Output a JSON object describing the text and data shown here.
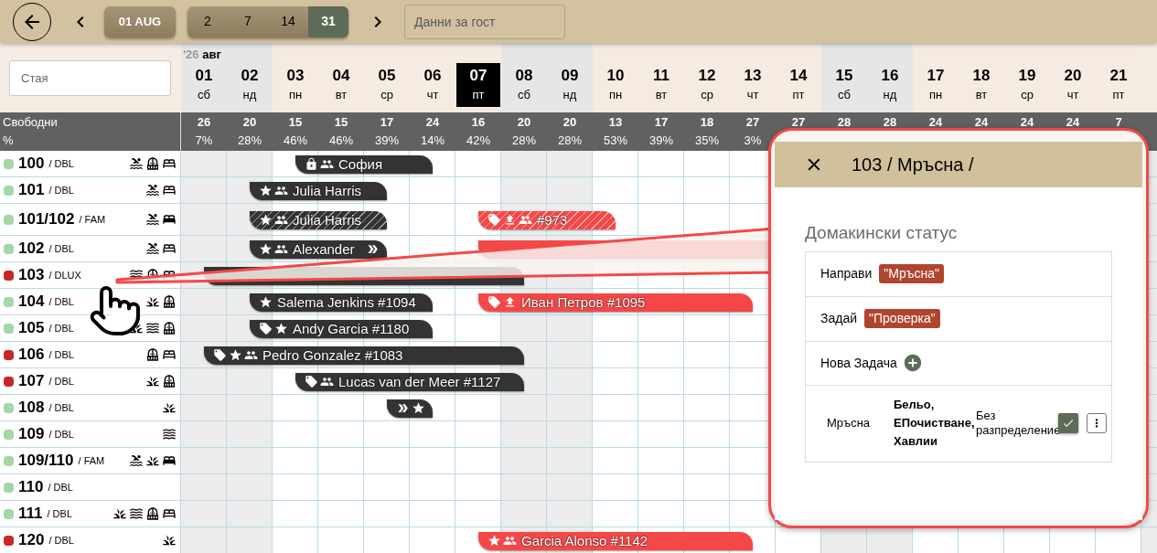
{
  "toolbar": {
    "date_button": "01 AUG",
    "ranges": [
      {
        "label": "2",
        "selected": false
      },
      {
        "label": "7",
        "selected": false
      },
      {
        "label": "14",
        "selected": false
      },
      {
        "label": "31",
        "selected": true
      }
    ],
    "guest_search": {
      "placeholder": "Данни за гост"
    }
  },
  "room_search": {
    "placeholder": "Стая"
  },
  "month": {
    "year": "'26",
    "name": "авг"
  },
  "stats_labels": [
    "Свободни",
    "%"
  ],
  "days": [
    {
      "date": "01",
      "weekday": "сб",
      "weekend": true,
      "selected": false,
      "free": "26",
      "pct": "7%"
    },
    {
      "date": "02",
      "weekday": "нд",
      "weekend": true,
      "selected": false,
      "free": "20",
      "pct": "28%"
    },
    {
      "date": "03",
      "weekday": "пн",
      "weekend": false,
      "selected": false,
      "free": "15",
      "pct": "46%"
    },
    {
      "date": "04",
      "weekday": "вт",
      "weekend": false,
      "selected": false,
      "free": "15",
      "pct": "46%"
    },
    {
      "date": "05",
      "weekday": "ср",
      "weekend": false,
      "selected": false,
      "free": "17",
      "pct": "39%"
    },
    {
      "date": "06",
      "weekday": "чт",
      "weekend": false,
      "selected": false,
      "free": "24",
      "pct": "14%"
    },
    {
      "date": "07",
      "weekday": "пт",
      "weekend": false,
      "selected": true,
      "free": "16",
      "pct": "42%"
    },
    {
      "date": "08",
      "weekday": "сб",
      "weekend": true,
      "selected": false,
      "free": "20",
      "pct": "28%"
    },
    {
      "date": "09",
      "weekday": "нд",
      "weekend": true,
      "selected": false,
      "free": "20",
      "pct": "28%"
    },
    {
      "date": "10",
      "weekday": "пн",
      "weekend": false,
      "selected": false,
      "free": "13",
      "pct": "53%"
    },
    {
      "date": "11",
      "weekday": "вт",
      "weekend": false,
      "selected": false,
      "free": "17",
      "pct": "39%"
    },
    {
      "date": "12",
      "weekday": "ср",
      "weekend": false,
      "selected": false,
      "free": "18",
      "pct": "35%"
    },
    {
      "date": "13",
      "weekday": "чт",
      "weekend": false,
      "selected": false,
      "free": "27",
      "pct": "3%"
    },
    {
      "date": "14",
      "weekday": "пт",
      "weekend": false,
      "selected": false,
      "free": "27"
    },
    {
      "date": "15",
      "weekday": "сб",
      "weekend": true,
      "selected": false,
      "free": "28"
    },
    {
      "date": "16",
      "weekday": "нд",
      "weekend": true,
      "selected": false,
      "free": "28"
    },
    {
      "date": "17",
      "weekday": "пн",
      "weekend": false,
      "selected": false,
      "free": "24"
    },
    {
      "date": "18",
      "weekday": "вт",
      "weekend": false,
      "selected": false,
      "free": "24"
    },
    {
      "date": "19",
      "weekday": "ср",
      "weekend": false,
      "selected": false,
      "free": "24"
    },
    {
      "date": "20",
      "weekday": "чт",
      "weekend": false,
      "selected": false,
      "free": "24"
    },
    {
      "date": "21",
      "weekday": "пт",
      "weekend": false,
      "selected": false,
      "free": "7"
    }
  ],
  "rooms": [
    {
      "number": "100",
      "type": "/ DBL",
      "color": "#a5d6a7",
      "tall": false,
      "amenities": [
        {
          "kind": "pool"
        },
        {
          "kind": "balcony"
        },
        {
          "kind": "bed"
        }
      ],
      "timeline": [
        {
          "kind": "gap"
        },
        {
          "kind": "gap"
        },
        {
          "kind": "booking",
          "color": "#333333",
          "striped": false,
          "icons": [
            {
              "kind": "lock"
            },
            {
              "kind": "people"
            }
          ],
          "label": "София",
          "nights": [
            {
              "kind": "night"
            },
            {
              "kind": "night"
            },
            {
              "kind": "night"
            }
          ]
        }
      ]
    },
    {
      "number": "101",
      "type": "/ DBL",
      "color": "#a5d6a7",
      "tall": false,
      "amenities": [
        {
          "kind": "pool"
        },
        {
          "kind": "bed"
        }
      ],
      "timeline": [
        {
          "kind": "gap"
        },
        {
          "kind": "booking",
          "color": "#333333",
          "striped": false,
          "icons": [
            {
              "kind": "star"
            },
            {
              "kind": "people"
            }
          ],
          "label": "Julia Harris",
          "nights": [
            {
              "kind": "night"
            },
            {
              "kind": "night"
            },
            {
              "kind": "night"
            }
          ]
        }
      ]
    },
    {
      "number": "101/102",
      "type": "/ FAM",
      "color": "#a5d6a7",
      "tall": true,
      "amenities": [
        {
          "kind": "pool"
        },
        {
          "kind": "bed-filled"
        }
      ],
      "timeline": [
        {
          "kind": "gap"
        },
        {
          "kind": "booking",
          "color": "#333333",
          "striped": true,
          "icons": [
            {
              "kind": "star"
            },
            {
              "kind": "people"
            }
          ],
          "label": "Julia Harris",
          "nights": [
            {
              "kind": "night"
            },
            {
              "kind": "night"
            },
            {
              "kind": "night"
            }
          ]
        },
        {
          "kind": "gap"
        },
        {
          "kind": "gap"
        },
        {
          "kind": "booking",
          "color": "#f44848",
          "striped": true,
          "icons": [
            {
              "kind": "tag"
            },
            {
              "kind": "upload"
            },
            {
              "kind": "people"
            }
          ],
          "label": "#973",
          "nights": [
            {
              "kind": "night"
            },
            {
              "kind": "night"
            },
            {
              "kind": "night"
            }
          ]
        }
      ]
    },
    {
      "number": "102",
      "type": "/ DBL",
      "color": "#a5d6a7",
      "tall": false,
      "amenities": [
        {
          "kind": "pool"
        },
        {
          "kind": "bed"
        }
      ],
      "timeline": [
        {
          "kind": "gap"
        },
        {
          "kind": "booking",
          "color": "#333333",
          "striped": false,
          "icons": [
            {
              "kind": "star"
            },
            {
              "kind": "people"
            }
          ],
          "label": "Alexander",
          "end_icons": [
            {
              "kind": "double-arrow"
            }
          ],
          "nights": [
            {
              "kind": "night"
            },
            {
              "kind": "night"
            },
            {
              "kind": "night"
            }
          ]
        },
        {
          "kind": "gap"
        },
        {
          "kind": "gap"
        },
        {
          "kind": "booking",
          "color": "#f44848",
          "striped": false,
          "nights": [
            {
              "kind": "night"
            },
            {
              "kind": "night"
            },
            {
              "kind": "night"
            },
            {
              "kind": "night"
            },
            {
              "kind": "night"
            },
            {
              "kind": "night"
            },
            {
              "kind": "night"
            }
          ]
        }
      ]
    },
    {
      "number": "103",
      "type": "/ DLUX",
      "color": "#c62828",
      "tall": false,
      "amenities": [
        {
          "kind": "waves"
        },
        {
          "kind": "balcony"
        },
        {
          "kind": "bed"
        }
      ],
      "timeline": [
        {
          "kind": "booking",
          "color": "#333333",
          "striped": false,
          "nights": [
            {
              "kind": "night"
            },
            {
              "kind": "night"
            },
            {
              "kind": "night"
            },
            {
              "kind": "night"
            },
            {
              "kind": "night"
            },
            {
              "kind": "night"
            },
            {
              "kind": "night"
            }
          ]
        }
      ]
    },
    {
      "number": "104",
      "type": "/ DBL",
      "color": "#a5d6a7",
      "tall": false,
      "amenities": [
        {
          "kind": "plant"
        },
        {
          "kind": "balcony"
        }
      ],
      "timeline": [
        {
          "kind": "gap"
        },
        {
          "kind": "booking",
          "color": "#333333",
          "striped": false,
          "icons": [
            {
              "kind": "star"
            }
          ],
          "label": "Salema Jenkins #1094",
          "nights": [
            {
              "kind": "night"
            },
            {
              "kind": "night"
            },
            {
              "kind": "night"
            },
            {
              "kind": "night"
            }
          ]
        },
        {
          "kind": "gap"
        },
        {
          "kind": "booking",
          "color": "#f44848",
          "striped": false,
          "icons": [
            {
              "kind": "tag"
            },
            {
              "kind": "upload"
            }
          ],
          "label": "Иван Петров #1095",
          "nights": [
            {
              "kind": "night"
            },
            {
              "kind": "night"
            },
            {
              "kind": "night"
            },
            {
              "kind": "night"
            },
            {
              "kind": "night"
            },
            {
              "kind": "night"
            }
          ]
        }
      ]
    },
    {
      "number": "105",
      "type": "/ DBL",
      "color": "#a5d6a7",
      "tall": false,
      "amenities": [
        {
          "kind": "plant"
        },
        {
          "kind": "waves"
        },
        {
          "kind": "balcony"
        }
      ],
      "timeline": [
        {
          "kind": "gap"
        },
        {
          "kind": "booking",
          "color": "#333333",
          "striped": false,
          "icons": [
            {
              "kind": "tag"
            },
            {
              "kind": "star"
            }
          ],
          "label": "Andy Garcia #1180",
          "nights": [
            {
              "kind": "night"
            },
            {
              "kind": "night"
            },
            {
              "kind": "night"
            },
            {
              "kind": "night"
            }
          ]
        }
      ]
    },
    {
      "number": "106",
      "type": "/ DBL",
      "color": "#c62828",
      "tall": false,
      "amenities": [
        {
          "kind": "balcony"
        },
        {
          "kind": "bed"
        }
      ],
      "timeline": [
        {
          "kind": "booking",
          "color": "#333333",
          "striped": false,
          "icons": [
            {
              "kind": "tag"
            },
            {
              "kind": "star"
            },
            {
              "kind": "people"
            }
          ],
          "label": "Pedro Gonzalez #1083",
          "nights": [
            {
              "kind": "night"
            },
            {
              "kind": "night"
            },
            {
              "kind": "night"
            },
            {
              "kind": "night"
            },
            {
              "kind": "night"
            },
            {
              "kind": "night"
            },
            {
              "kind": "night"
            }
          ]
        }
      ]
    },
    {
      "number": "107",
      "type": "/ DBL",
      "color": "#c62828",
      "tall": false,
      "amenities": [
        {
          "kind": "plant"
        },
        {
          "kind": "balcony"
        }
      ],
      "timeline": [
        {
          "kind": "gap"
        },
        {
          "kind": "gap"
        },
        {
          "kind": "booking",
          "color": "#333333",
          "striped": false,
          "icons": [
            {
              "kind": "tag"
            },
            {
              "kind": "people"
            }
          ],
          "label": "Lucas van der Meer #1127",
          "nights": [
            {
              "kind": "night"
            },
            {
              "kind": "night"
            },
            {
              "kind": "night"
            },
            {
              "kind": "night"
            },
            {
              "kind": "night"
            }
          ]
        }
      ]
    },
    {
      "number": "108",
      "type": "/ DBL",
      "color": "#a5d6a7",
      "tall": false,
      "amenities": [
        {
          "kind": "plant"
        }
      ],
      "timeline": [
        {
          "kind": "gap"
        },
        {
          "kind": "gap"
        },
        {
          "kind": "gap"
        },
        {
          "kind": "gap"
        },
        {
          "kind": "booking",
          "color": "#333333",
          "striped": false,
          "icons": [
            {
              "kind": "double-arrow"
            },
            {
              "kind": "star"
            }
          ],
          "nights": [
            {
              "kind": "night"
            }
          ]
        }
      ]
    },
    {
      "number": "109",
      "type": "/ DBL",
      "color": "#a5d6a7",
      "tall": false,
      "amenities": [
        {
          "kind": "waves"
        }
      ]
    },
    {
      "number": "109/110",
      "type": "/ FAM",
      "color": "#a5d6a7",
      "tall": false,
      "amenities": [
        {
          "kind": "pool"
        },
        {
          "kind": "plant"
        },
        {
          "kind": "bed-filled"
        }
      ]
    },
    {
      "number": "110",
      "type": "/ DBL",
      "color": "#a5d6a7",
      "tall": false
    },
    {
      "number": "111",
      "type": "/ DBL",
      "color": "#a5d6a7",
      "tall": false,
      "amenities": [
        {
          "kind": "plant"
        },
        {
          "kind": "waves"
        },
        {
          "kind": "balcony"
        },
        {
          "kind": "bed"
        }
      ]
    },
    {
      "number": "120",
      "type": "/ DBL",
      "color": "#c62828",
      "tall": false,
      "amenities": [
        {
          "kind": "plant"
        }
      ],
      "timeline": [
        {
          "kind": "gap"
        },
        {
          "kind": "gap"
        },
        {
          "kind": "gap"
        },
        {
          "kind": "gap"
        },
        {
          "kind": "gap"
        },
        {
          "kind": "gap"
        },
        {
          "kind": "booking",
          "color": "#f44848",
          "striped": false,
          "icons": [
            {
              "kind": "star"
            },
            {
              "kind": "people"
            }
          ],
          "label": "Garcia Alonso #1142",
          "nights": [
            {
              "kind": "night"
            },
            {
              "kind": "night"
            },
            {
              "kind": "night"
            },
            {
              "kind": "night"
            },
            {
              "kind": "night"
            },
            {
              "kind": "night"
            }
          ]
        }
      ]
    }
  ],
  "popup": {
    "title": "103 / Мръсна /",
    "section": "Домакински статус",
    "actions": [
      {
        "label": "Направи",
        "badge": "\"Мръсна\""
      },
      {
        "label": "Задай",
        "badge": "\"Проверка\""
      }
    ],
    "new_task": "Нова Задача",
    "task": {
      "status": "Мръсна",
      "items": "Бельо, ЕПочистване, Хавлии",
      "assignee": "Без разпределение",
      "checked": true
    }
  }
}
